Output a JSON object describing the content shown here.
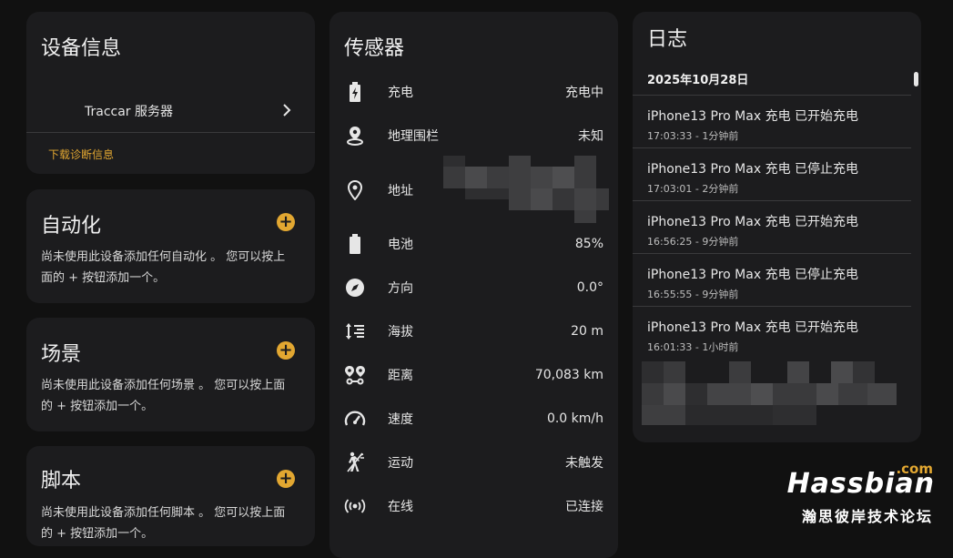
{
  "device_info": {
    "title": "设备信息",
    "server_label": "Traccar 服务器",
    "download_link": "下载诊断信息"
  },
  "automation": {
    "title": "自动化",
    "description": "尚未使用此设备添加任何自动化 。 您可以按上面的 + 按钮添加一个。"
  },
  "scenes": {
    "title": "场景",
    "description": "尚未使用此设备添加任何场景 。 您可以按上面的 + 按钮添加一个。"
  },
  "scripts": {
    "title": "脚本",
    "description": "尚未使用此设备添加任何脚本 。 您可以按上面的 + 按钮添加一个。"
  },
  "add_symbol": "+",
  "sensors": {
    "title": "传感器",
    "items": [
      {
        "name": "充电",
        "value": "充电中",
        "icon": "battery-charging-icon"
      },
      {
        "name": "地理围栏",
        "value": "未知",
        "icon": "map-marker-radius-icon"
      },
      {
        "name": "地址",
        "value": "",
        "icon": "map-marker-icon"
      },
      {
        "name": "电池",
        "value": "85%",
        "icon": "battery-icon"
      },
      {
        "name": "方向",
        "value": "0.0°",
        "icon": "compass-icon"
      },
      {
        "name": "海拔",
        "value": "20 m",
        "icon": "altitude-icon"
      },
      {
        "name": "距离",
        "value": "70,083 km",
        "icon": "map-marker-distance-icon"
      },
      {
        "name": "速度",
        "value": "0.0 km/h",
        "icon": "speedometer-icon"
      },
      {
        "name": "运动",
        "value": "未触发",
        "icon": "walk-icon"
      },
      {
        "name": "在线",
        "value": "已连接",
        "icon": "online-signal-icon"
      }
    ]
  },
  "logbook": {
    "title": "日志",
    "date": "2025年10月28日",
    "entries": [
      {
        "message": "iPhone13 Pro Max 充电 已开始充电",
        "time": "17:03:33 - 1分钟前"
      },
      {
        "message": "iPhone13 Pro Max 充电 已停止充电",
        "time": "17:03:01 - 2分钟前"
      },
      {
        "message": "iPhone13 Pro Max 充电 已开始充电",
        "time": "16:56:25 - 9分钟前"
      },
      {
        "message": "iPhone13 Pro Max 充电 已停止充电",
        "time": "16:55:55 - 9分钟前"
      },
      {
        "message": "iPhone13 Pro Max 充电 已开始充电",
        "time": "16:01:33 - 1小时前"
      }
    ]
  },
  "watermark": {
    "brand": "Hassbian",
    "tld": ".com",
    "tagline": "瀚思彼岸技术论坛"
  },
  "colors": {
    "background": "#111111",
    "card": "#1c1c1e",
    "accent": "#e2a731",
    "divider": "#3a3a3c"
  }
}
